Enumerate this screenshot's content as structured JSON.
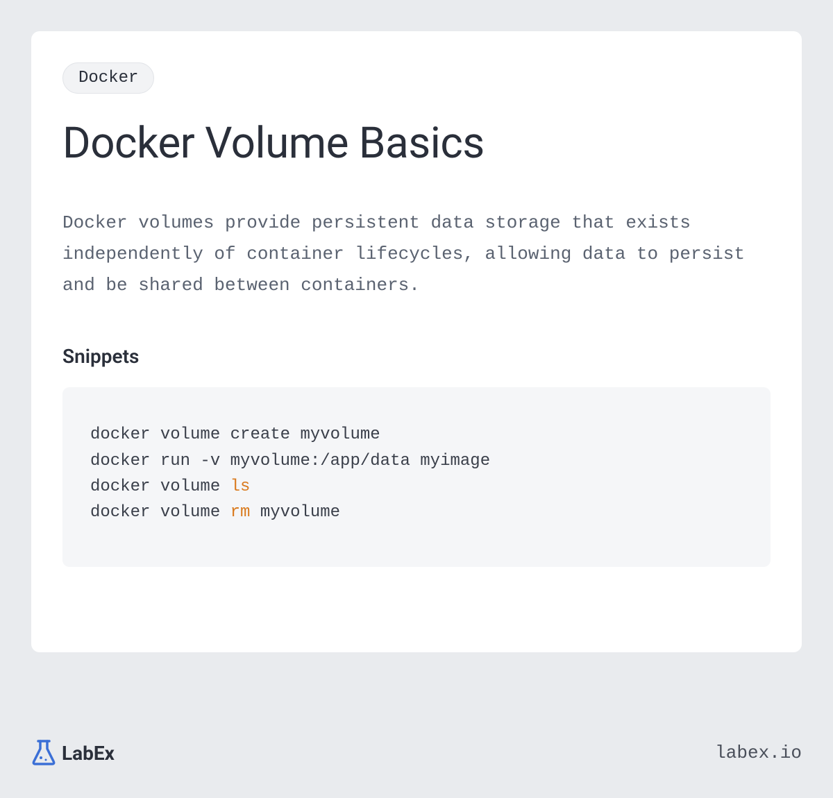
{
  "tag": "Docker",
  "title": "Docker Volume Basics",
  "intro": "Docker volumes provide persistent data storage that exists independently of container lifecycles, allowing data to persist and be shared between containers.",
  "section_heading": "Snippets",
  "code": {
    "line1": "docker volume create myvolume",
    "line2": "docker run -v myvolume:/app/data myimage",
    "line3_a": "docker volume ",
    "line3_kw": "ls",
    "line4_a": "docker volume ",
    "line4_kw": "rm",
    "line4_b": " myvolume"
  },
  "brand": "LabEx",
  "site_url": "labex.io"
}
